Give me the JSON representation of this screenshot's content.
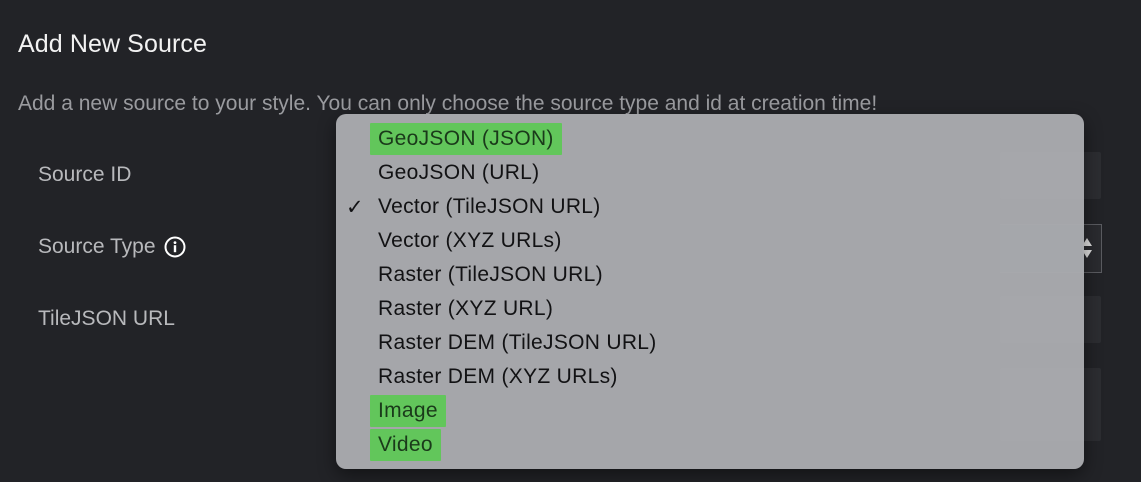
{
  "dialog": {
    "title": "Add New Source",
    "description": "Add a new source to your style. You can only choose the source type and id at creation time!"
  },
  "fields": {
    "source_id_label": "Source ID",
    "source_type_label": "Source Type",
    "tilejson_url_label": "TileJSON URL"
  },
  "dropdown": {
    "selected": "Vector (TileJSON URL)",
    "options": [
      {
        "label": "GeoJSON (JSON)",
        "highlighted": true,
        "checked": false
      },
      {
        "label": "GeoJSON (URL)",
        "highlighted": false,
        "checked": false
      },
      {
        "label": "Vector (TileJSON URL)",
        "highlighted": false,
        "checked": true
      },
      {
        "label": "Vector (XYZ URLs)",
        "highlighted": false,
        "checked": false
      },
      {
        "label": "Raster (TileJSON URL)",
        "highlighted": false,
        "checked": false
      },
      {
        "label": "Raster (XYZ URL)",
        "highlighted": false,
        "checked": false
      },
      {
        "label": "Raster DEM (TileJSON URL)",
        "highlighted": false,
        "checked": false
      },
      {
        "label": "Raster DEM (XYZ URLs)",
        "highlighted": false,
        "checked": false
      },
      {
        "label": "Image",
        "highlighted": true,
        "checked": false
      },
      {
        "label": "Video",
        "highlighted": true,
        "checked": false
      }
    ],
    "checkmark_glyph": "✓",
    "highlight_color": "#62c65b"
  },
  "icons": {
    "info": "info-circle-icon",
    "stepper": "select-stepper-icon"
  }
}
